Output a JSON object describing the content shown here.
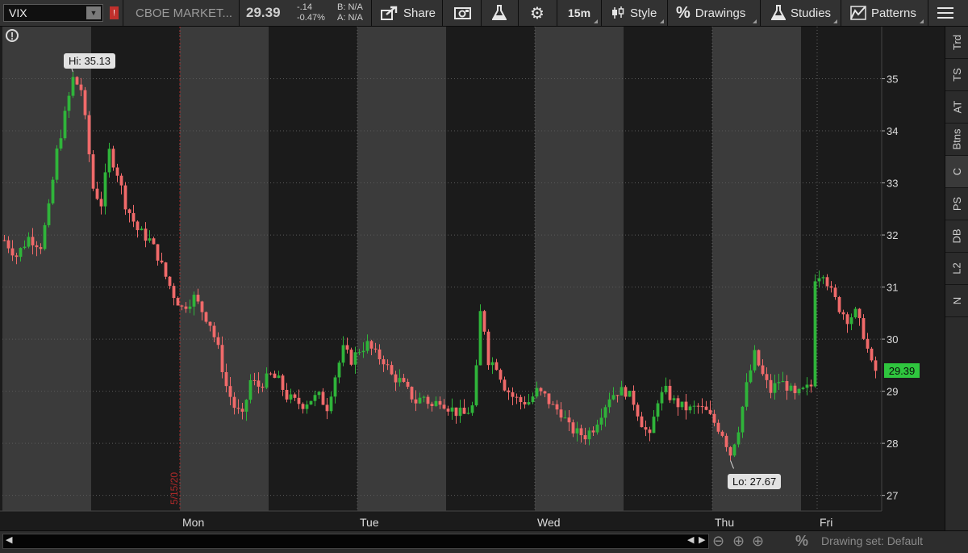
{
  "toolbar": {
    "symbol": "VIX",
    "description": "CBOE MARKET...",
    "last": "29.39",
    "change": "-.14",
    "change_pct": "-0.47%",
    "bid": "B: N/A",
    "ask": "A: N/A",
    "share_label": "Share",
    "interval_label": "15m",
    "style_label": "Style",
    "drawings_label": "Drawings",
    "studies_label": "Studies",
    "patterns_label": "Patterns"
  },
  "side_tabs": [
    "Trd",
    "TS",
    "AT",
    "Btns",
    "C",
    "PS",
    "DB",
    "L2",
    "N"
  ],
  "bottom": {
    "drawing_set": "Drawing set: Default"
  },
  "colors": {
    "up": "#2fb43a",
    "down": "#f06a6a",
    "session_light": "#3b3b3b",
    "session_dark": "#1b1b1b",
    "last_badge": "#2fc63e"
  },
  "chart_data": {
    "type": "candlestick",
    "symbol": "VIX",
    "interval": "15m",
    "ylim": [
      26.7,
      36.0
    ],
    "yticks": [
      27,
      28,
      29,
      30,
      31,
      32,
      33,
      34,
      35
    ],
    "days": [
      "",
      "Mon",
      "Tue",
      "Wed",
      "Thu",
      "Fri"
    ],
    "day_marker": "5/15/20",
    "high_label": "Hi: 35.13",
    "low_label": "Lo: 27.67",
    "last_label": "29.39",
    "high": 35.13,
    "low": 27.67,
    "last": 29.39,
    "price_path": [
      [
        0,
        31.9
      ],
      [
        3,
        31.6
      ],
      [
        6,
        31.95
      ],
      [
        9,
        31.8
      ],
      [
        11,
        32.5
      ],
      [
        13,
        33.6
      ],
      [
        15,
        34.3
      ],
      [
        17,
        35.0
      ],
      [
        19,
        34.8
      ],
      [
        20,
        34.2
      ],
      [
        22,
        32.9
      ],
      [
        24,
        32.6
      ],
      [
        26,
        33.6
      ],
      [
        28,
        33.2
      ],
      [
        30,
        32.6
      ],
      [
        33,
        32.1
      ],
      [
        36,
        31.9
      ],
      [
        38,
        31.6
      ],
      [
        40,
        31.2
      ],
      [
        42,
        30.85
      ],
      [
        44,
        30.6
      ],
      [
        47,
        30.8
      ],
      [
        49,
        30.55
      ],
      [
        51,
        30.3
      ],
      [
        53,
        29.8
      ],
      [
        55,
        29.1
      ],
      [
        57,
        28.7
      ],
      [
        59,
        28.5
      ],
      [
        61,
        29.2
      ],
      [
        63,
        29.1
      ],
      [
        66,
        29.3
      ],
      [
        68,
        29.2
      ],
      [
        70,
        28.9
      ],
      [
        72,
        28.8
      ],
      [
        74,
        28.75
      ],
      [
        76,
        28.85
      ],
      [
        78,
        28.9
      ],
      [
        80,
        28.7
      ],
      [
        82,
        29.3
      ],
      [
        84,
        29.8
      ],
      [
        86,
        29.6
      ],
      [
        88,
        29.8
      ],
      [
        90,
        29.9
      ],
      [
        92,
        29.7
      ],
      [
        94,
        29.6
      ],
      [
        96,
        29.3
      ],
      [
        98,
        29.2
      ],
      [
        100,
        29.0
      ],
      [
        102,
        28.8
      ],
      [
        104,
        28.9
      ],
      [
        106,
        28.7
      ],
      [
        108,
        28.85
      ],
      [
        110,
        28.7
      ],
      [
        112,
        28.6
      ],
      [
        114,
        28.55
      ],
      [
        116,
        28.7
      ],
      [
        117,
        29.4
      ],
      [
        118,
        30.5
      ],
      [
        119,
        30.2
      ],
      [
        120,
        29.6
      ],
      [
        122,
        29.5
      ],
      [
        124,
        29.1
      ],
      [
        126,
        28.9
      ],
      [
        128,
        28.8
      ],
      [
        130,
        28.8
      ],
      [
        132,
        29.0
      ],
      [
        134,
        28.9
      ],
      [
        136,
        28.7
      ],
      [
        138,
        28.6
      ],
      [
        140,
        28.3
      ],
      [
        142,
        28.2
      ],
      [
        144,
        28.15
      ],
      [
        146,
        28.3
      ],
      [
        148,
        28.6
      ],
      [
        150,
        28.9
      ],
      [
        152,
        29.0
      ],
      [
        154,
        29.0
      ],
      [
        156,
        28.8
      ],
      [
        158,
        28.4
      ],
      [
        160,
        28.1
      ],
      [
        162,
        28.85
      ],
      [
        164,
        29.0
      ],
      [
        166,
        28.8
      ],
      [
        168,
        28.7
      ],
      [
        170,
        28.65
      ],
      [
        172,
        28.7
      ],
      [
        174,
        28.6
      ],
      [
        176,
        28.4
      ],
      [
        178,
        28.2
      ],
      [
        180,
        27.8
      ],
      [
        182,
        28.3
      ],
      [
        184,
        29.1
      ],
      [
        186,
        29.7
      ],
      [
        188,
        29.3
      ],
      [
        190,
        29.0
      ],
      [
        192,
        29.2
      ],
      [
        194,
        29.1
      ],
      [
        196,
        28.9
      ],
      [
        198,
        29.0
      ],
      [
        200,
        29.1
      ],
      [
        201,
        31.2
      ],
      [
        203,
        31.3
      ],
      [
        205,
        30.9
      ],
      [
        207,
        30.6
      ],
      [
        209,
        30.4
      ],
      [
        211,
        30.5
      ],
      [
        213,
        30.1
      ],
      [
        215,
        29.5
      ],
      [
        216,
        29.39
      ]
    ]
  }
}
